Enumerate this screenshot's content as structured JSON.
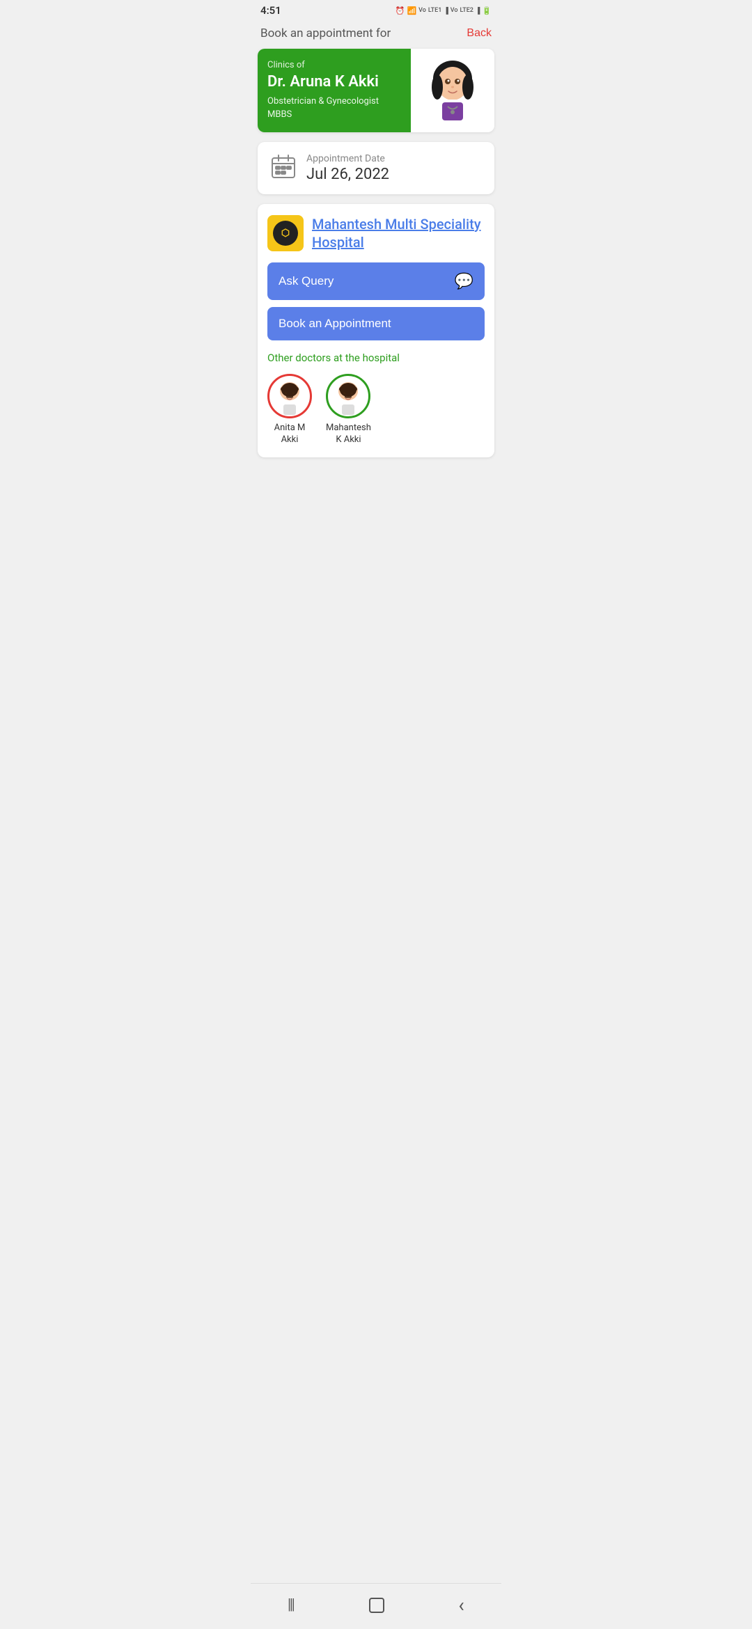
{
  "statusBar": {
    "time": "4:51",
    "icons": [
      "alarm",
      "wifi",
      "lte1",
      "signal1",
      "lte2",
      "signal2",
      "battery"
    ]
  },
  "header": {
    "title": "Book an appointment for",
    "backLabel": "Back"
  },
  "doctorCard": {
    "clinicsOf": "Clinics of",
    "doctorName": "Dr. Aruna K Akki",
    "specialty": "Obstetrician & Gynecologist",
    "degree": "MBBS",
    "avatarEmoji": "👩‍⚕️"
  },
  "appointmentDate": {
    "label": "Appointment Date",
    "value": "Jul 26, 2022"
  },
  "hospitalCard": {
    "hospitalName": "Mahantesh Multi Speciality Hospital",
    "askQueryLabel": "Ask Query",
    "bookAppointmentLabel": "Book an Appointment",
    "otherDoctorsLabel": "Other doctors at the hospital",
    "otherDoctors": [
      {
        "name": "Anita M Akki",
        "avatarEmoji": "👨‍⚕️",
        "borderColor": "red-border"
      },
      {
        "name": "Mahantesh K Akki",
        "avatarEmoji": "👨‍⚕️",
        "borderColor": "green-border"
      }
    ]
  },
  "navBar": {
    "recent": "|||",
    "home": "□",
    "back": "‹"
  }
}
